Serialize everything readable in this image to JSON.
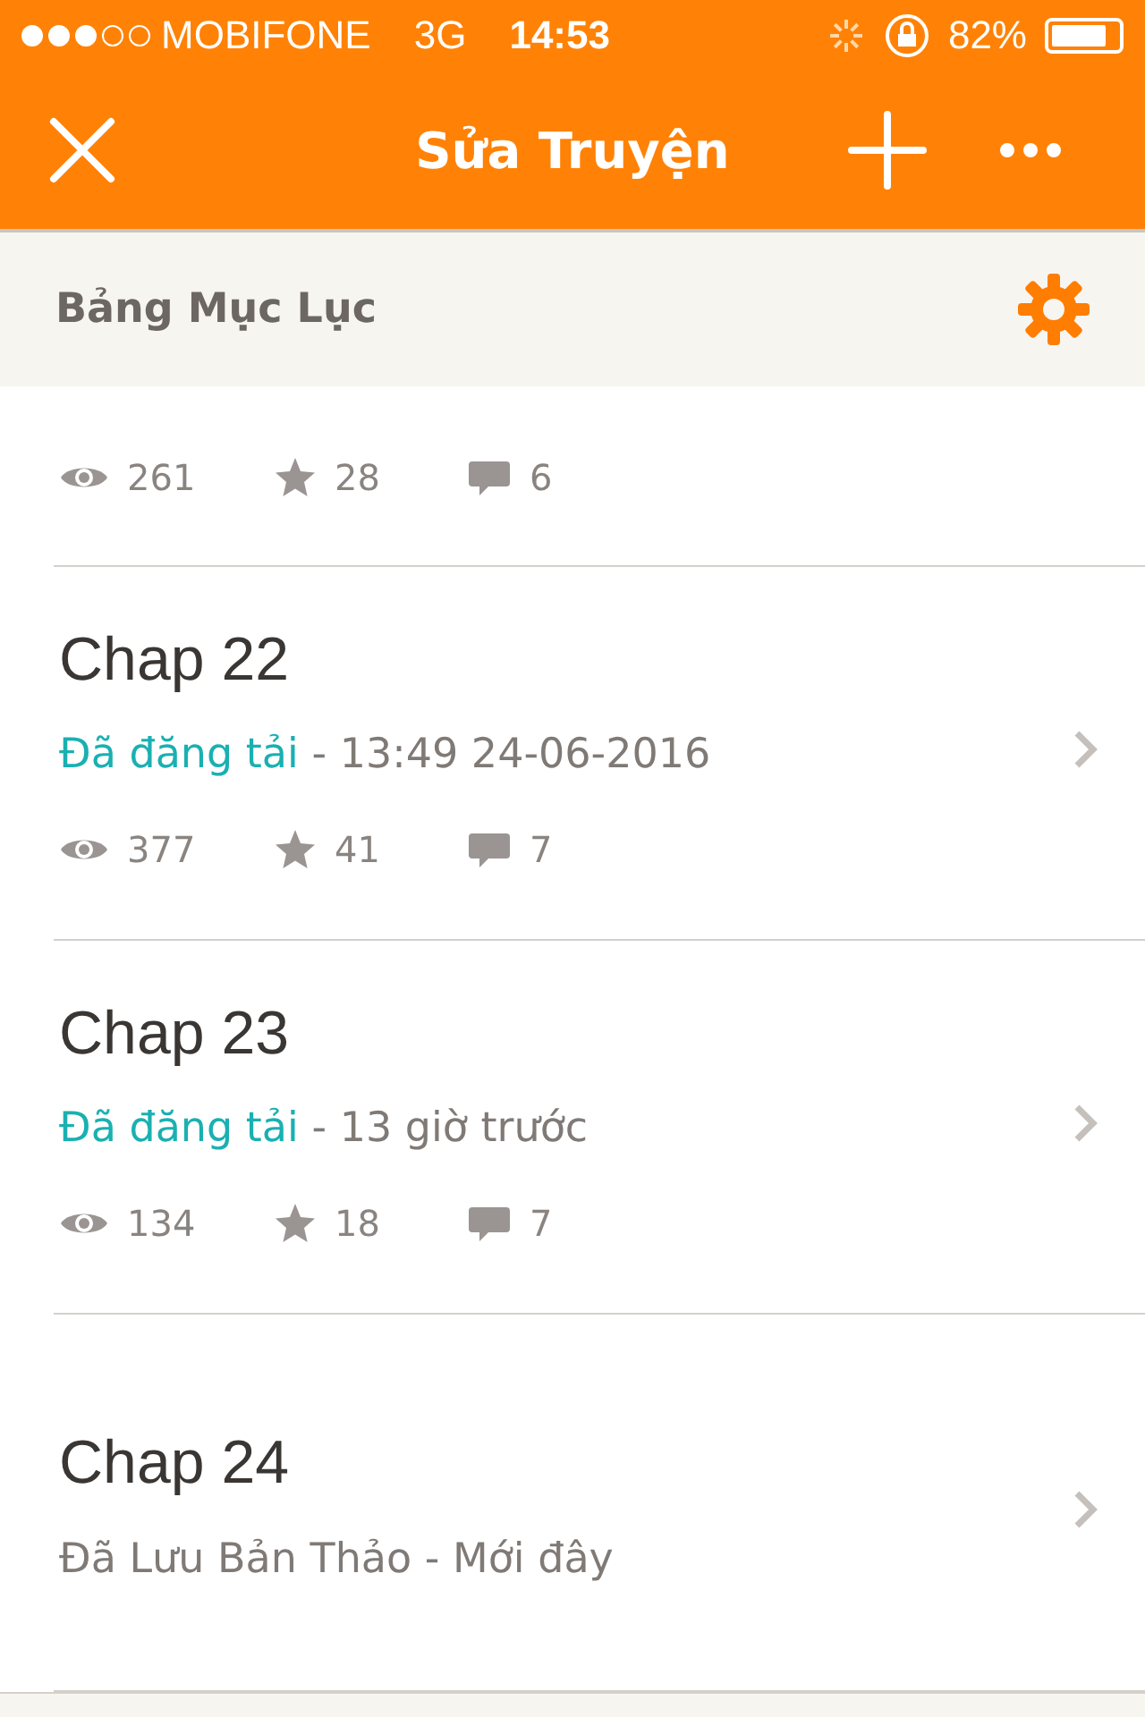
{
  "status_bar": {
    "signal_dots": [
      {
        "filled": true
      },
      {
        "filled": true
      },
      {
        "filled": true
      },
      {
        "filled": false
      },
      {
        "filled": false
      }
    ],
    "carrier": "MOBIFONE",
    "network": "3G",
    "time": "14:53",
    "battery": "82%"
  },
  "nav_bar": {
    "title": "Sửa Truyện"
  },
  "section": {
    "title": "Bảng Mục Lục"
  },
  "chapters": [
    {
      "kind": "clipped",
      "views": "261",
      "votes": "28",
      "comments": "6"
    },
    {
      "kind": "published",
      "title": "Chap 22",
      "status": "Đã đăng tải",
      "time": " - 13:49 24-06-2016",
      "views": "377",
      "votes": "41",
      "comments": "7"
    },
    {
      "kind": "published",
      "title": "Chap 23",
      "status": "Đã đăng tải",
      "time": " - 13 giờ trước",
      "views": "134",
      "votes": "18",
      "comments": "7"
    },
    {
      "kind": "draft",
      "title": "Chap 24",
      "status": "Đã Lưu Bản Thảo - Mới đây"
    }
  ]
}
